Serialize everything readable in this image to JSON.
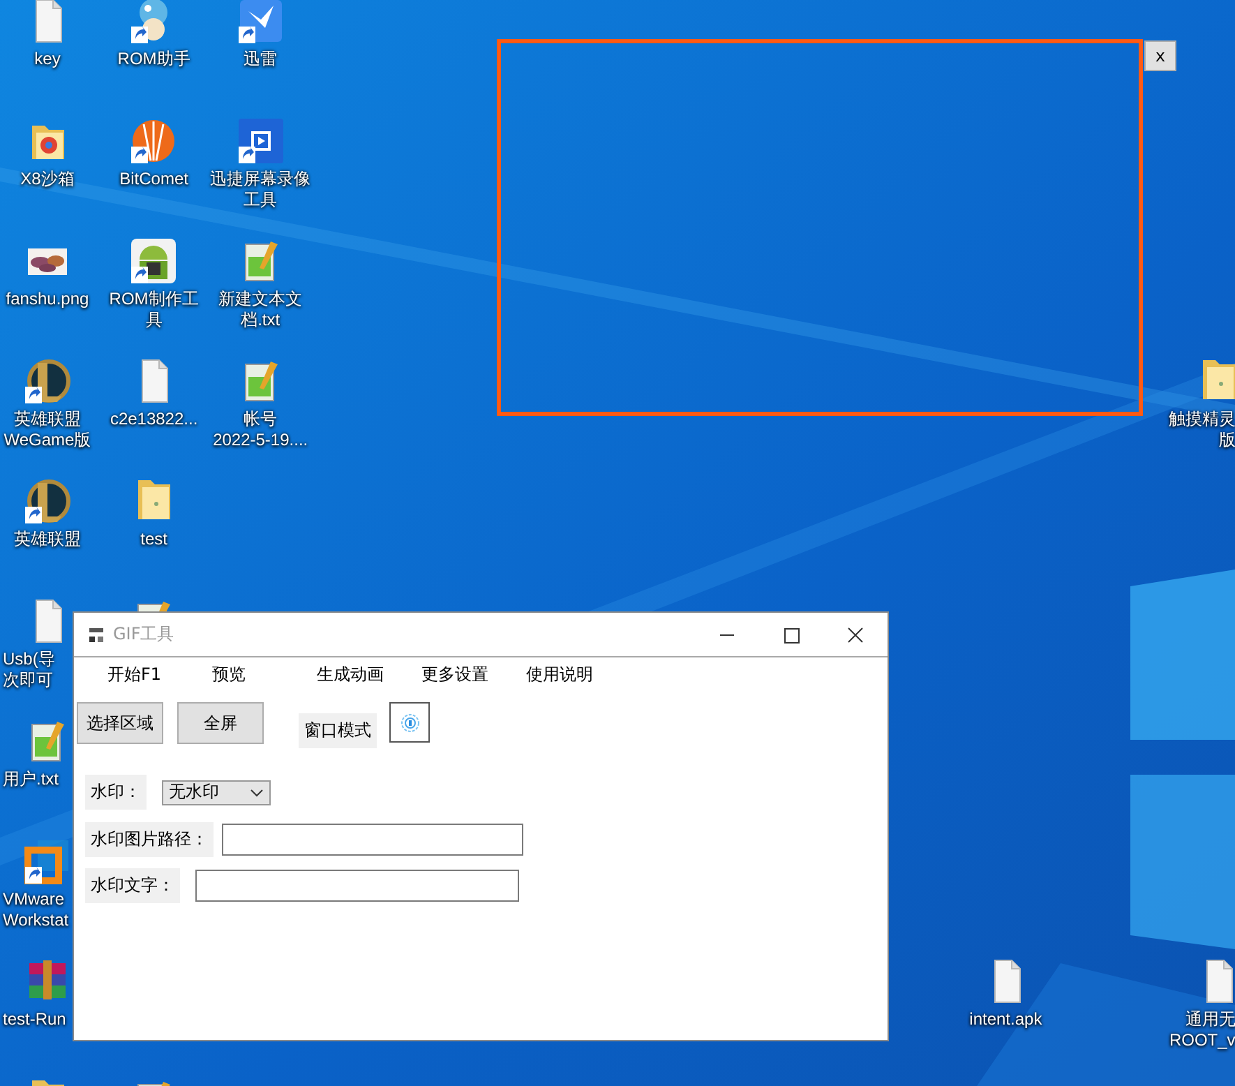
{
  "desktop": {
    "icons": [
      {
        "lines": [
          "key"
        ],
        "kind": "file",
        "shortcut": false
      },
      {
        "lines": [
          "ROM助手"
        ],
        "kind": "mascot",
        "shortcut": true
      },
      {
        "lines": [
          "迅雷"
        ],
        "kind": "bird",
        "shortcut": true
      },
      {
        "lines": [
          "X8沙箱"
        ],
        "kind": "browserfolder",
        "shortcut": false
      },
      {
        "lines": [
          "BitComet"
        ],
        "kind": "sphere",
        "shortcut": true
      },
      {
        "lines": [
          "迅捷屏幕录像",
          "工具"
        ],
        "kind": "video",
        "shortcut": true
      },
      {
        "lines": [
          "fanshu.png"
        ],
        "shortcut": false
      },
      {
        "lines": [
          "ROM制作工",
          "具"
        ],
        "kind": "android",
        "shortcut": true
      },
      {
        "lines": [
          "新建文本文",
          "档.txt"
        ],
        "kind": "notepad",
        "shortcut": false
      },
      {
        "lines": [
          "英雄联盟",
          "WeGame版"
        ],
        "kind": "game",
        "shortcut": true
      },
      {
        "lines": [
          "c2e13822..."
        ],
        "kind": "file",
        "shortcut": false
      },
      {
        "lines": [
          "帐号",
          "2022-5-19...."
        ],
        "kind": "notepad",
        "shortcut": false
      },
      {
        "lines": [
          "触摸精灵",
          "版"
        ],
        "kind": "folder",
        "shortcut": false
      },
      {
        "lines": [
          "英雄联盟"
        ],
        "kind": "game",
        "shortcut": true
      },
      {
        "lines": [
          "test"
        ],
        "kind": "folder",
        "shortcut": false
      },
      {
        "lines": [
          "Usb(导",
          "次即可"
        ],
        "kind": "file",
        "shortcut": false
      },
      {
        "kind": "notepad"
      },
      {
        "lines": [
          "用户.txt"
        ],
        "kind": "notepad",
        "shortcut": false
      },
      {
        "lines": [
          "VMware",
          "Workstat"
        ],
        "kind": "vmware",
        "shortcut": true
      },
      {
        "lines": [
          "test-Run"
        ],
        "kind": "archive",
        "shortcut": false
      },
      {
        "lines": [
          "intent.apk"
        ],
        "kind": "file",
        "shortcut": false
      },
      {
        "lines": [
          "通用无",
          "ROOT_v"
        ],
        "kind": "file",
        "shortcut": false
      },
      {
        "kind": "folder"
      },
      {
        "kind": "notepad"
      }
    ]
  },
  "capture_frame": {
    "close_label": "x"
  },
  "window": {
    "title": "GIF工具",
    "active": false,
    "menu": [
      {
        "label": "开始F1"
      },
      {
        "label": "预览"
      },
      {
        "label": "生成动画"
      },
      {
        "label": "更多设置"
      },
      {
        "label": "使用说明"
      }
    ],
    "buttons": [
      {
        "label": "选择区域"
      },
      {
        "label": "全屏"
      }
    ],
    "mode_label": "窗口模式",
    "watermark": {
      "label": "水印：",
      "value": "无水印"
    },
    "image_path": {
      "label": "水印图片路径："
    },
    "watermark_text": {
      "label": "水印文字："
    }
  }
}
